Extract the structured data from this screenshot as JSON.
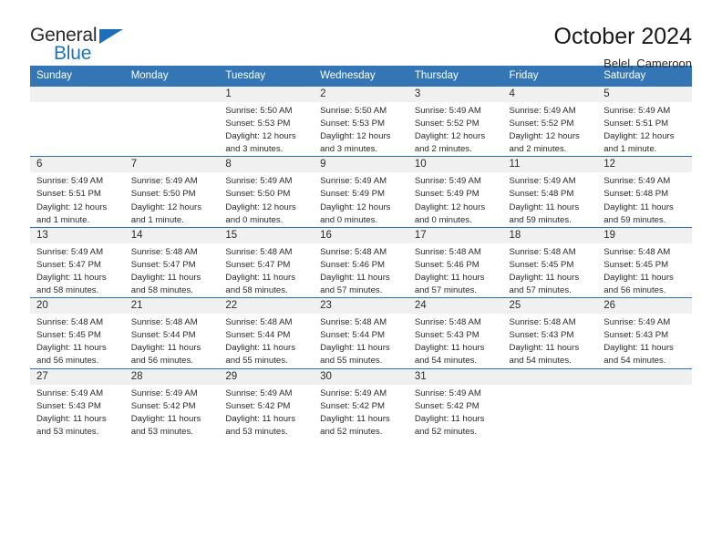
{
  "brand": {
    "name_top": "General",
    "name_bottom": "Blue",
    "accent_color": "#1c6fb8"
  },
  "header": {
    "title": "October 2024",
    "subtitle": "Belel, Cameroon"
  },
  "theme": {
    "header_bg": "#3476b5",
    "row_divider": "#2f72b3",
    "daynum_band_bg": "#f0f0f0",
    "text": "#2b2b2b"
  },
  "weekday_headers": [
    "Sunday",
    "Monday",
    "Tuesday",
    "Wednesday",
    "Thursday",
    "Friday",
    "Saturday"
  ],
  "weeks": [
    [
      {
        "day": "",
        "lines": []
      },
      {
        "day": "",
        "lines": []
      },
      {
        "day": "1",
        "lines": [
          "Sunrise: 5:50 AM",
          "Sunset: 5:53 PM",
          "Daylight: 12 hours and 3 minutes."
        ]
      },
      {
        "day": "2",
        "lines": [
          "Sunrise: 5:50 AM",
          "Sunset: 5:53 PM",
          "Daylight: 12 hours and 3 minutes."
        ]
      },
      {
        "day": "3",
        "lines": [
          "Sunrise: 5:49 AM",
          "Sunset: 5:52 PM",
          "Daylight: 12 hours and 2 minutes."
        ]
      },
      {
        "day": "4",
        "lines": [
          "Sunrise: 5:49 AM",
          "Sunset: 5:52 PM",
          "Daylight: 12 hours and 2 minutes."
        ]
      },
      {
        "day": "5",
        "lines": [
          "Sunrise: 5:49 AM",
          "Sunset: 5:51 PM",
          "Daylight: 12 hours and 1 minute."
        ]
      }
    ],
    [
      {
        "day": "6",
        "lines": [
          "Sunrise: 5:49 AM",
          "Sunset: 5:51 PM",
          "Daylight: 12 hours and 1 minute."
        ]
      },
      {
        "day": "7",
        "lines": [
          "Sunrise: 5:49 AM",
          "Sunset: 5:50 PM",
          "Daylight: 12 hours and 1 minute."
        ]
      },
      {
        "day": "8",
        "lines": [
          "Sunrise: 5:49 AM",
          "Sunset: 5:50 PM",
          "Daylight: 12 hours and 0 minutes."
        ]
      },
      {
        "day": "9",
        "lines": [
          "Sunrise: 5:49 AM",
          "Sunset: 5:49 PM",
          "Daylight: 12 hours and 0 minutes."
        ]
      },
      {
        "day": "10",
        "lines": [
          "Sunrise: 5:49 AM",
          "Sunset: 5:49 PM",
          "Daylight: 12 hours and 0 minutes."
        ]
      },
      {
        "day": "11",
        "lines": [
          "Sunrise: 5:49 AM",
          "Sunset: 5:48 PM",
          "Daylight: 11 hours and 59 minutes."
        ]
      },
      {
        "day": "12",
        "lines": [
          "Sunrise: 5:49 AM",
          "Sunset: 5:48 PM",
          "Daylight: 11 hours and 59 minutes."
        ]
      }
    ],
    [
      {
        "day": "13",
        "lines": [
          "Sunrise: 5:49 AM",
          "Sunset: 5:47 PM",
          "Daylight: 11 hours and 58 minutes."
        ]
      },
      {
        "day": "14",
        "lines": [
          "Sunrise: 5:48 AM",
          "Sunset: 5:47 PM",
          "Daylight: 11 hours and 58 minutes."
        ]
      },
      {
        "day": "15",
        "lines": [
          "Sunrise: 5:48 AM",
          "Sunset: 5:47 PM",
          "Daylight: 11 hours and 58 minutes."
        ]
      },
      {
        "day": "16",
        "lines": [
          "Sunrise: 5:48 AM",
          "Sunset: 5:46 PM",
          "Daylight: 11 hours and 57 minutes."
        ]
      },
      {
        "day": "17",
        "lines": [
          "Sunrise: 5:48 AM",
          "Sunset: 5:46 PM",
          "Daylight: 11 hours and 57 minutes."
        ]
      },
      {
        "day": "18",
        "lines": [
          "Sunrise: 5:48 AM",
          "Sunset: 5:45 PM",
          "Daylight: 11 hours and 57 minutes."
        ]
      },
      {
        "day": "19",
        "lines": [
          "Sunrise: 5:48 AM",
          "Sunset: 5:45 PM",
          "Daylight: 11 hours and 56 minutes."
        ]
      }
    ],
    [
      {
        "day": "20",
        "lines": [
          "Sunrise: 5:48 AM",
          "Sunset: 5:45 PM",
          "Daylight: 11 hours and 56 minutes."
        ]
      },
      {
        "day": "21",
        "lines": [
          "Sunrise: 5:48 AM",
          "Sunset: 5:44 PM",
          "Daylight: 11 hours and 56 minutes."
        ]
      },
      {
        "day": "22",
        "lines": [
          "Sunrise: 5:48 AM",
          "Sunset: 5:44 PM",
          "Daylight: 11 hours and 55 minutes."
        ]
      },
      {
        "day": "23",
        "lines": [
          "Sunrise: 5:48 AM",
          "Sunset: 5:44 PM",
          "Daylight: 11 hours and 55 minutes."
        ]
      },
      {
        "day": "24",
        "lines": [
          "Sunrise: 5:48 AM",
          "Sunset: 5:43 PM",
          "Daylight: 11 hours and 54 minutes."
        ]
      },
      {
        "day": "25",
        "lines": [
          "Sunrise: 5:48 AM",
          "Sunset: 5:43 PM",
          "Daylight: 11 hours and 54 minutes."
        ]
      },
      {
        "day": "26",
        "lines": [
          "Sunrise: 5:49 AM",
          "Sunset: 5:43 PM",
          "Daylight: 11 hours and 54 minutes."
        ]
      }
    ],
    [
      {
        "day": "27",
        "lines": [
          "Sunrise: 5:49 AM",
          "Sunset: 5:43 PM",
          "Daylight: 11 hours and 53 minutes."
        ]
      },
      {
        "day": "28",
        "lines": [
          "Sunrise: 5:49 AM",
          "Sunset: 5:42 PM",
          "Daylight: 11 hours and 53 minutes."
        ]
      },
      {
        "day": "29",
        "lines": [
          "Sunrise: 5:49 AM",
          "Sunset: 5:42 PM",
          "Daylight: 11 hours and 53 minutes."
        ]
      },
      {
        "day": "30",
        "lines": [
          "Sunrise: 5:49 AM",
          "Sunset: 5:42 PM",
          "Daylight: 11 hours and 52 minutes."
        ]
      },
      {
        "day": "31",
        "lines": [
          "Sunrise: 5:49 AM",
          "Sunset: 5:42 PM",
          "Daylight: 11 hours and 52 minutes."
        ]
      },
      {
        "day": "",
        "lines": []
      },
      {
        "day": "",
        "lines": []
      }
    ]
  ]
}
